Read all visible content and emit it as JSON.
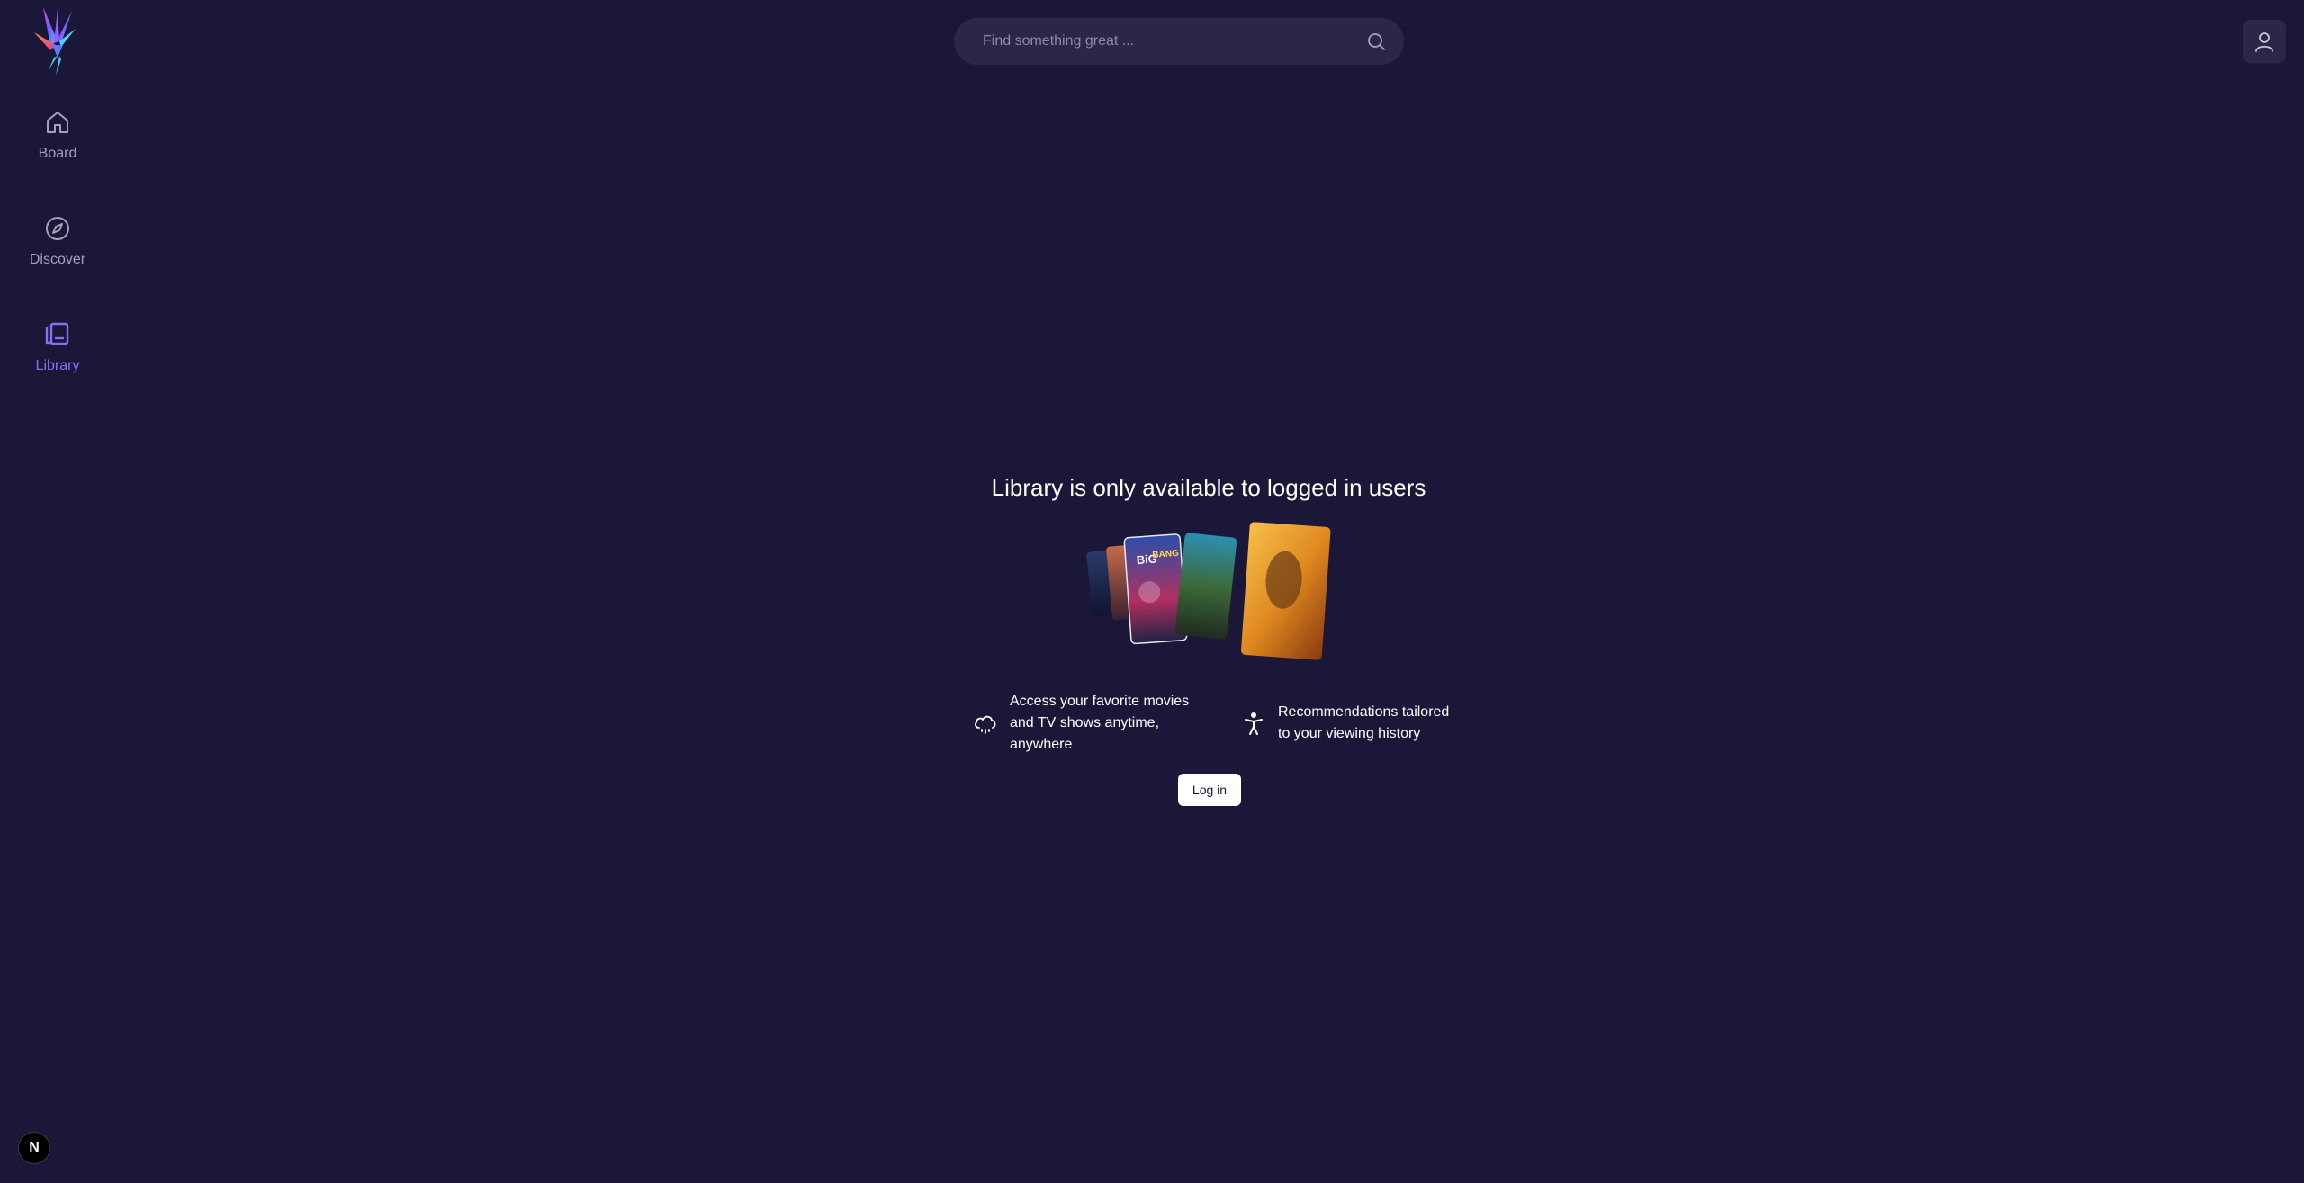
{
  "sidebar": {
    "logo_icon": "bird-logo",
    "items": [
      {
        "label": "Board",
        "icon": "home-icon",
        "active": false
      },
      {
        "label": "Discover",
        "icon": "compass-icon",
        "active": false
      },
      {
        "label": "Library",
        "icon": "library-icon",
        "active": true
      }
    ]
  },
  "search": {
    "placeholder": "Find something great ...",
    "value": "",
    "icon": "search-icon"
  },
  "header": {
    "profile_icon": "user-icon"
  },
  "main": {
    "title": "Library is only available to logged in users",
    "features": [
      {
        "icon": "cloud-icon",
        "text": "Access your favorite movies and TV shows anytime, anywhere"
      },
      {
        "icon": "accessibility-icon",
        "text": "Recommendations tailored to your viewing history"
      }
    ],
    "login_label": "Log in"
  },
  "dev_badge": {
    "label": "N",
    "icon": "nextjs-icon"
  },
  "colors": {
    "background": "#1a1738",
    "accent": "#8b6cf5",
    "nav_inactive": "#a3a3b8",
    "search_bg": "#2a2748"
  }
}
